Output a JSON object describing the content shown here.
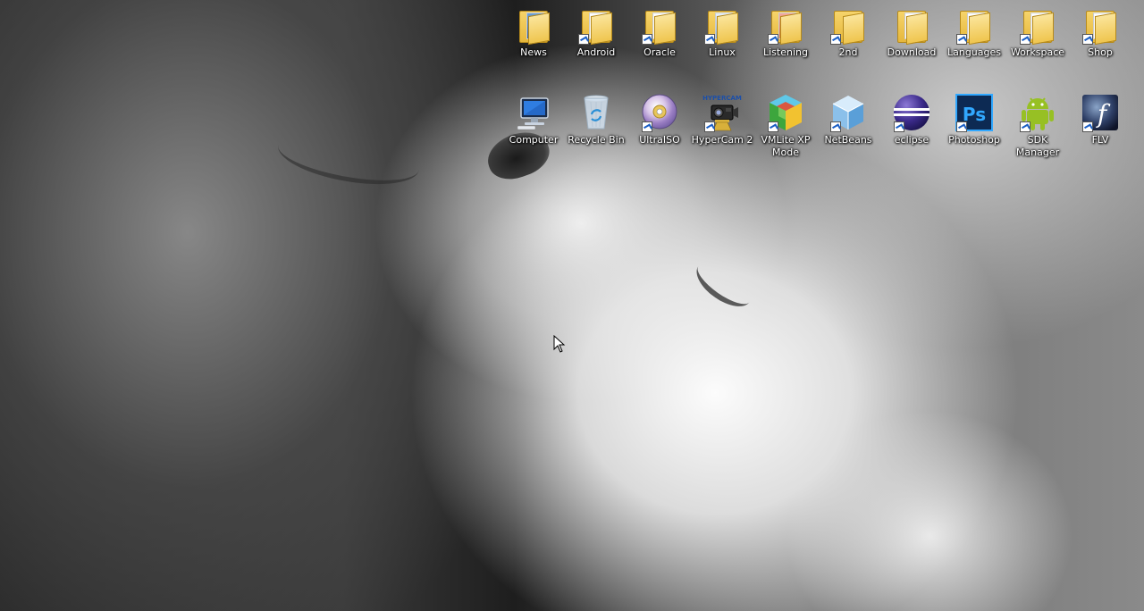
{
  "desktop": {
    "icons_row1": [
      {
        "label": "News",
        "type": "folder"
      },
      {
        "label": "Android",
        "type": "folder"
      },
      {
        "label": "Oracle",
        "type": "folder"
      },
      {
        "label": "Linux",
        "type": "folder"
      },
      {
        "label": "Listening",
        "type": "folder"
      },
      {
        "label": "2nd",
        "type": "folder"
      },
      {
        "label": "Download",
        "type": "folder"
      },
      {
        "label": "Languages",
        "type": "folder"
      },
      {
        "label": "Workspace",
        "type": "folder"
      },
      {
        "label": "Shop",
        "type": "folder"
      }
    ],
    "icons_row2": [
      {
        "label": "Computer",
        "icon": "computer-icon"
      },
      {
        "label": "Recycle Bin",
        "icon": "recycle-bin-icon"
      },
      {
        "label": "UltraISO",
        "icon": "disc-icon"
      },
      {
        "label": "HyperCam 2",
        "icon": "camera-icon",
        "icon_text": "HYPERCAM"
      },
      {
        "label": "VMLite XP Mode",
        "icon": "cube-icon"
      },
      {
        "label": "NetBeans",
        "icon": "netbeans-cube-icon"
      },
      {
        "label": "eclipse",
        "icon": "eclipse-icon"
      },
      {
        "label": "Photoshop",
        "icon": "photoshop-icon",
        "icon_text": "Ps"
      },
      {
        "label": "SDK Manager",
        "icon": "android-icon"
      },
      {
        "label": "FLV",
        "icon": "flash-icon",
        "icon_text": "f"
      }
    ]
  },
  "colors": {
    "label_text": "#ffffff",
    "shortcut_arrow": "#1c5fc4",
    "folder": "#e6b73b",
    "photoshop_bg": "#0d2a53",
    "photoshop_text": "#31a8ff",
    "android_green": "#97c024"
  }
}
